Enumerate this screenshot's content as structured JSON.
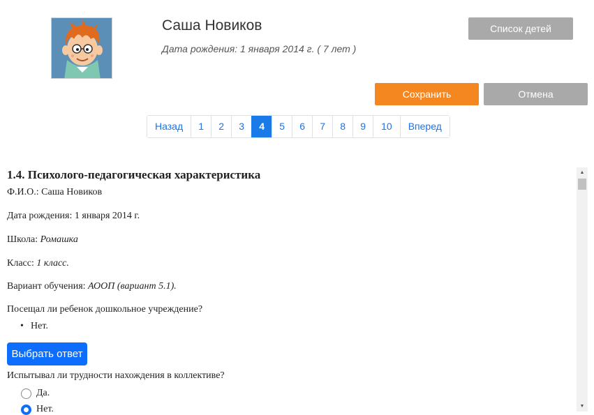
{
  "profile": {
    "name": "Саша Новиков",
    "birth_line": "Дата рождения: 1 января 2014 г. ( 7 лет )"
  },
  "buttons": {
    "children_list": "Список детей",
    "save": "Сохранить",
    "cancel": "Отмена"
  },
  "pagination": {
    "prev": "Назад",
    "pages": [
      "1",
      "2",
      "3",
      "4",
      "5",
      "6",
      "7",
      "8",
      "9",
      "10"
    ],
    "active": "4",
    "next": "Вперед"
  },
  "form": {
    "title": "1.4. Психолого-педагогическая характеристика",
    "fio_label": "Ф.И.О.:",
    "fio_value": "Саша Новиков",
    "birth_label": "Дата рождения:",
    "birth_value": "1 января 2014 г.",
    "school_label": "Школа:",
    "school_value": "Ромашка",
    "class_label": "Класс:",
    "class_value": "1 класс.",
    "variant_label": "Вариант обучения:",
    "variant_value": "АООП (вариант 5.1).",
    "q1": "Посещал ли ребенок дошкольное учреждение?",
    "q1_answer": "Нет.",
    "choose_answer": "Выбрать ответ",
    "q2": "Испытывал ли трудности нахождения в коллективе?",
    "q2_options": [
      "Да.",
      "Нет."
    ],
    "q2_selected": "Нет."
  },
  "colors": {
    "accent_orange": "#f58720",
    "primary_blue": "#0d6efd",
    "gray_button": "#a9a9a9"
  }
}
